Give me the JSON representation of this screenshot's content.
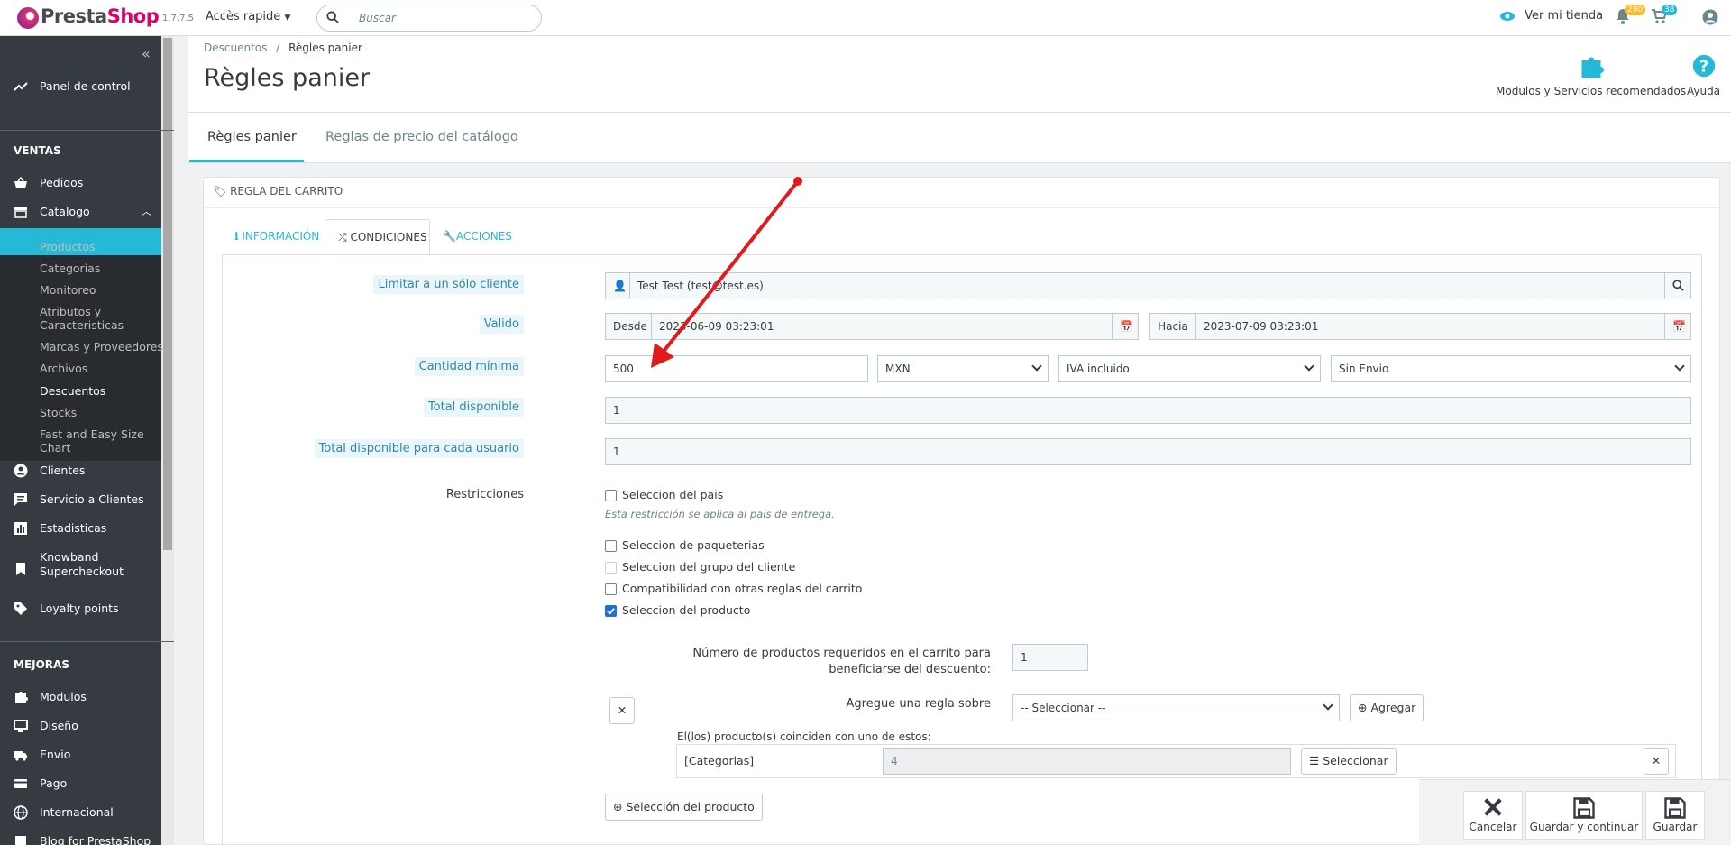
{
  "header": {
    "logo_text_a": "Presta",
    "logo_text_b": "Shop",
    "version": "1.7.7.5",
    "quick_access": "Accès rapide",
    "search_placeholder": "Buscar",
    "view_store": "Ver mi tienda",
    "notif_badge_1": "290",
    "notif_badge_2": "38"
  },
  "sidebar": {
    "dashboard": "Panel de control",
    "section_sales": "VENTAS",
    "orders": "Pedidos",
    "catalog": "Catalogo",
    "catalog_items": [
      "Productos",
      "Categorias",
      "Monitoreo",
      "Atributos y",
      "Caracteristicas",
      "Marcas y Proveedores",
      "Archivos",
      "Descuentos",
      "Stocks",
      "Fast and Easy Size Chart"
    ],
    "customers": "Clientes",
    "customer_service": "Servicio a Clientes",
    "stats": "Estadisticas",
    "knowband_1": "Knowband",
    "knowband_2": "Supercheckout",
    "loyalty": "Loyalty points",
    "section_improve": "MEJORAS",
    "modules": "Modulos",
    "design": "Diseño",
    "shipping": "Envio",
    "payment": "Pago",
    "international": "Internacional",
    "blog": "Blog for PrestaShop"
  },
  "toolbar": {
    "breadcrumb_parent": "Descuentos",
    "breadcrumb_sep": "/",
    "breadcrumb_current": "Règles panier",
    "title": "Règles panier",
    "modules_label": "Modulos y Servicios recomendados",
    "help_label": "Ayuda"
  },
  "tabs": [
    "Règles panier",
    "Reglas de precio del catálogo"
  ],
  "panel": {
    "heading": "REGLA DEL CARRITO",
    "form_tabs": [
      "INFORMACIÓN",
      "CONDICIONES",
      "ACCIONES"
    ]
  },
  "form": {
    "limit_label": "Limitar a un sólo cliente",
    "limit_value": "Test Test (test@test.es)",
    "valid_label": "Valido",
    "from_label": "Desde",
    "from_value": "2023-06-09 03:23:01",
    "to_label": "Hacia",
    "to_value": "2023-07-09 03:23:01",
    "min_amount_label": "Cantidad mínima",
    "min_amount_value": "500",
    "currency": "MXN",
    "tax": "IVA incluido",
    "shipping": "Sin Envio",
    "total_label": "Total disponible",
    "total_value": "1",
    "per_user_label": "Total disponible para cada usuario",
    "per_user_value": "1",
    "restrictions_label": "Restricciones",
    "r_country": "Seleccion del pais",
    "r_country_hint": "Esta restricción se aplica al país de entrega.",
    "r_carrier": "Seleccion de paqueterias",
    "r_group": "Seleccion del grupo del cliente",
    "r_compat": "Compatibilidad con otras reglas del carrito",
    "r_product": "Seleccion del producto",
    "qty_label_1": "Número de productos requeridos en el carrito para",
    "qty_label_2": "beneficiarse del descuento:",
    "qty_value": "1",
    "add_rule_label": "Agregue una regla sobre",
    "add_rule_select": "-- Seleccionar --",
    "add_btn": "Agregar",
    "match_text": "El(los) producto(s) coinciden con uno de estos:",
    "cat_label": "[Categorias]",
    "cat_value": "4",
    "select_btn": "Seleccionar",
    "product_sel_btn": "Selección del producto"
  },
  "footer": {
    "cancel": "Cancelar",
    "save_continue": "Guardar y continuar",
    "save": "Guardar"
  },
  "colors": {
    "accent": "#25b9d7",
    "sidebar": "#363a41",
    "arrow": "#e01b1b"
  }
}
